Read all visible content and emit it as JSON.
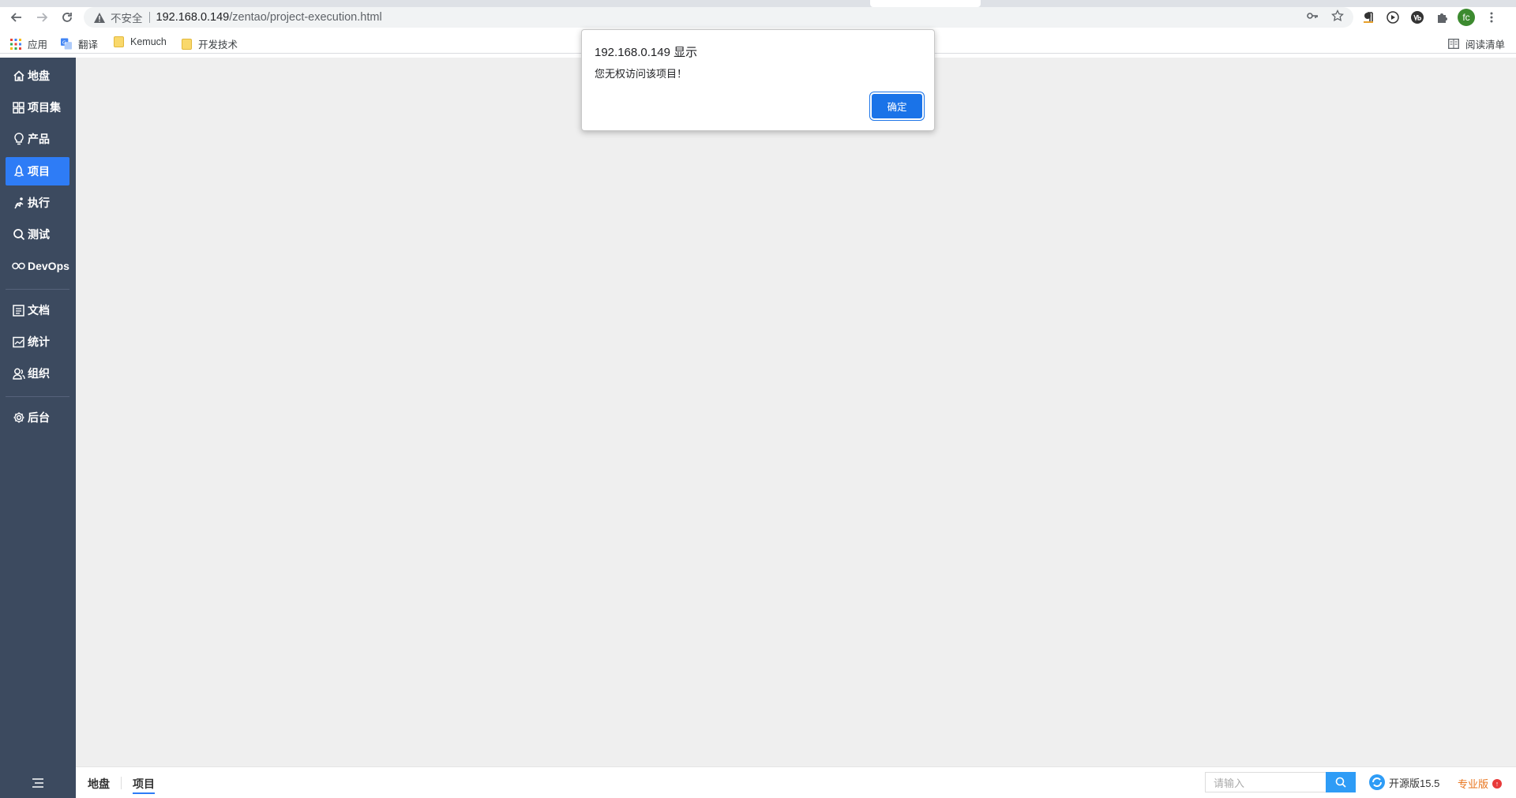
{
  "browser": {
    "insecure_label": "不安全",
    "url_host": "192.168.0.149",
    "url_path": "/zentao/project-execution.html",
    "profile_initials": "fc",
    "bookmarks": [
      {
        "label": "应用",
        "icon": "apps-grid-icon"
      },
      {
        "label": "翻译",
        "icon": "translate-icon"
      },
      {
        "label": "Kemuch",
        "icon": "folder-icon"
      },
      {
        "label": "开发技术",
        "icon": "folder-icon"
      }
    ],
    "reading_list": "阅读清单"
  },
  "sidebar": {
    "items": [
      {
        "label": "地盘",
        "icon": "home-icon"
      },
      {
        "label": "项目集",
        "icon": "grid-icon"
      },
      {
        "label": "产品",
        "icon": "lightbulb-icon"
      },
      {
        "label": "项目",
        "icon": "rocket-icon",
        "active": true
      },
      {
        "label": "执行",
        "icon": "run-icon"
      },
      {
        "label": "测试",
        "icon": "magnifier-icon"
      },
      {
        "label": "DevOps",
        "icon": "infinity-icon"
      },
      {
        "label": "文档",
        "icon": "document-icon"
      },
      {
        "label": "统计",
        "icon": "chart-icon"
      },
      {
        "label": "组织",
        "icon": "people-icon"
      },
      {
        "label": "后台",
        "icon": "gear-icon"
      }
    ]
  },
  "footer": {
    "breadcrumbs": [
      "地盘",
      "项目"
    ],
    "search_placeholder": "请输入",
    "edition": "开源版15.5",
    "pro_label": "专业版"
  },
  "dialog": {
    "title": "192.168.0.149 显示",
    "message": "您无权访问该项目！",
    "ok_label": "确定"
  },
  "colors": {
    "sidebar_bg": "#3c4a5f",
    "accent": "#2e7cf6",
    "main_bg": "#efefef"
  }
}
